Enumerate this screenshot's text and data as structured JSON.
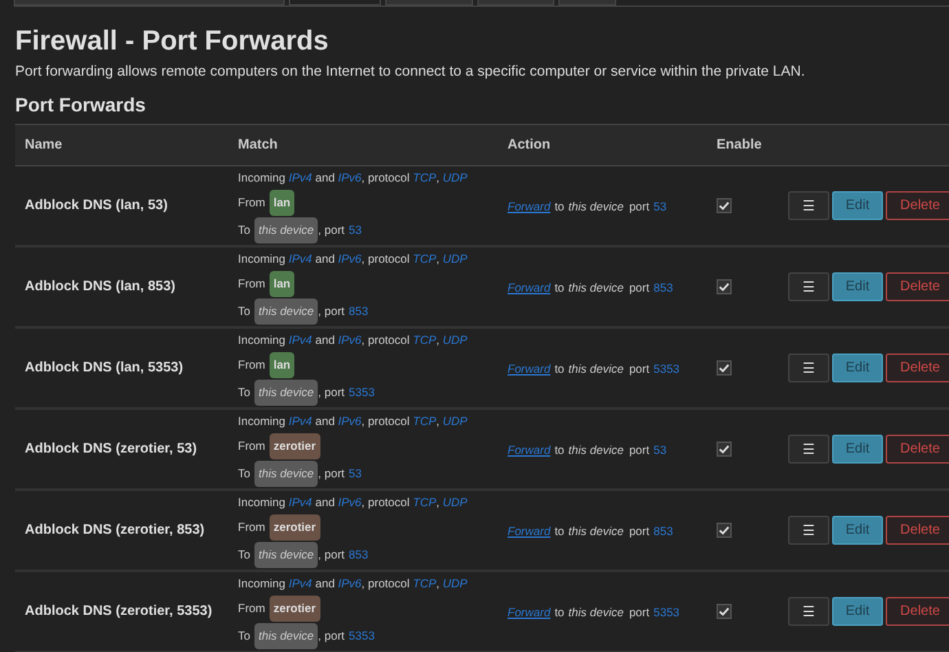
{
  "page": {
    "title": "Firewall - Port Forwards",
    "description": "Port forwarding allows remote computers on the Internet to connect to a specific computer or service within the private LAN."
  },
  "section_title": "Port Forwards",
  "table": {
    "columns": [
      "Name",
      "Match",
      "Action",
      "Enable"
    ],
    "rows": [
      {
        "name": "Adblock DNS (lan, 53)",
        "incoming": "Incoming *IPv4* and *IPv6*, protocol *TCP*, *UDP*",
        "from_label": "From",
        "zone": {
          "name": "lan",
          "color": "#4f7a4c"
        },
        "to_label": "To",
        "destination": "this device",
        "port_label": ", port",
        "port": "53",
        "action": "Forward",
        "action_to": "to",
        "action_target": "this device",
        "action_port_label": "port",
        "action_port": "53",
        "enabled": true,
        "buttons": [
          "☰",
          "Edit",
          "Delete"
        ]
      },
      {
        "name": "Adblock DNS (lan, 853)",
        "incoming": "Incoming *IPv4* and *IPv6*, protocol *TCP*, *UDP*",
        "from_label": "From",
        "zone": {
          "name": "lan",
          "color": "#4f7a4c"
        },
        "to_label": "To",
        "destination": "this device",
        "port_label": ", port",
        "port": "853",
        "action": "Forward",
        "action_to": "to",
        "action_target": "this device",
        "action_port_label": "port",
        "action_port": "853",
        "enabled": true,
        "buttons": [
          "☰",
          "Edit",
          "Delete"
        ]
      },
      {
        "name": "Adblock DNS (lan, 5353)",
        "incoming": "Incoming *IPv4* and *IPv6*, protocol *TCP*, *UDP*",
        "from_label": "From",
        "zone": {
          "name": "lan",
          "color": "#4f7a4c"
        },
        "to_label": "To",
        "destination": "this device",
        "port_label": ", port",
        "port": "5353",
        "action": "Forward",
        "action_to": "to",
        "action_target": "this device",
        "action_port_label": "port",
        "action_port": "5353",
        "enabled": true,
        "buttons": [
          "☰",
          "Edit",
          "Delete"
        ]
      },
      {
        "name": "Adblock DNS (zerotier, 53)",
        "incoming": "Incoming *IPv4* and *IPv6*, protocol *TCP*, *UDP*",
        "from_label": "From",
        "zone": {
          "name": "zerotier",
          "color": "#6b5246"
        },
        "to_label": "To",
        "destination": "this device",
        "port_label": ", port",
        "port": "53",
        "action": "Forward",
        "action_to": "to",
        "action_target": "this device",
        "action_port_label": "port",
        "action_port": "53",
        "enabled": true,
        "buttons": [
          "☰",
          "Edit",
          "Delete"
        ]
      },
      {
        "name": "Adblock DNS (zerotier, 853)",
        "incoming": "Incoming *IPv4* and *IPv6*, protocol *TCP*, *UDP*",
        "from_label": "From",
        "zone": {
          "name": "zerotier",
          "color": "#6b5246"
        },
        "to_label": "To",
        "destination": "this device",
        "port_label": ", port",
        "port": "853",
        "action": "Forward",
        "action_to": "to",
        "action_target": "this device",
        "action_port_label": "port",
        "action_port": "853",
        "enabled": true,
        "buttons": [
          "☰",
          "Edit",
          "Delete"
        ]
      },
      {
        "name": "Adblock DNS (zerotier, 5353)",
        "incoming": "Incoming *IPv4* and *IPv6*, protocol *TCP*, *UDP*",
        "from_label": "From",
        "zone": {
          "name": "zerotier",
          "color": "#6b5246"
        },
        "to_label": "To",
        "destination": "this device",
        "port_label": ", port",
        "port": "5353",
        "action": "Forward",
        "action_to": "to",
        "action_target": "this device",
        "action_port_label": "port",
        "action_port": "5353",
        "enabled": true,
        "buttons": [
          "☰",
          "Edit",
          "Delete"
        ]
      }
    ]
  }
}
